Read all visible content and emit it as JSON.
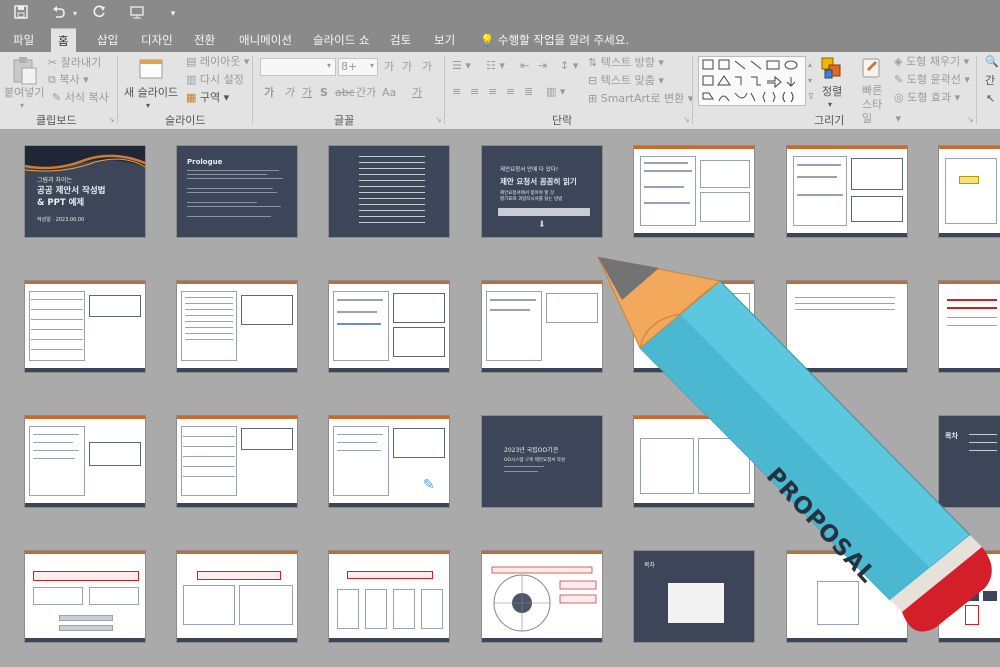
{
  "qat": {
    "save_icon": "save-icon",
    "undo_icon": "undo-icon",
    "redo_icon": "redo-icon",
    "customize_icon": "customize-icon"
  },
  "tabs": [
    "파일",
    "홈",
    "삽입",
    "디자인",
    "전환",
    "애니메이션",
    "슬라이드 쇼",
    "검토",
    "보기"
  ],
  "tell_me": "수행할 작업을 알려 주세요.",
  "clipboard": {
    "paste": "붙여넣기",
    "cut": "잘라내기",
    "copy": "복사",
    "format_painter": "서식 복사",
    "label": "클립보드"
  },
  "slides_group": {
    "new_slide": "새 슬라이드",
    "layout": "레이아웃",
    "reset": "다시 설정",
    "section": "구역",
    "label": "슬라이드"
  },
  "font_group": {
    "font_name": "",
    "font_size": "8+",
    "grow": "가",
    "shrink": "가",
    "clear": "가",
    "bold": "가",
    "italic": "가",
    "underline": "가",
    "shadow": "S",
    "strike": "abc",
    "spacing": "간가",
    "case": "Aa",
    "color": "가",
    "label": "글꼴"
  },
  "paragraph_group": {
    "text_direction": "텍스트 방향",
    "align_text": "텍스트 맞춤",
    "smartart": "SmartArt로 변환",
    "label": "단락"
  },
  "drawing_group": {
    "arrange": "정렬",
    "quick_styles": "빠른 스타일",
    "shape_fill": "도형 채우기",
    "shape_outline": "도형 윤곽선",
    "shape_effects": "도형 효과",
    "label": "그리기"
  },
  "editing_partial": "간",
  "slides": {
    "s1": {
      "line1": "그림과 차이는",
      "line2": "공공 제안서 작성법",
      "line3": "& PPT 예제",
      "sub": "작성일 · 2023.00.00"
    },
    "s2": {
      "title": "Prologue"
    },
    "s4": {
      "line1": "제안요청서 안에 다 있다!",
      "line2": "제안 요청서 꼼꼼히 읽기",
      "sub1": "제안요청서에서 찾아야 할 것",
      "sub2": "평가표와 과업지시서를 읽는 방법"
    },
    "s17": {
      "line1": "2023년 국립OO기관",
      "line2": "OO시스템 구축 제안요청서 작성"
    },
    "s18": {
      "title": "목차"
    },
    "s22": {
      "title": "목차"
    }
  },
  "pencil": {
    "label": "PROPOSAL",
    "colors": {
      "body": "#5bc8e0",
      "tip": "#f2a95c",
      "lead": "#737373",
      "ferrule": "#e6e2da",
      "eraser": "#d41e2a"
    }
  }
}
